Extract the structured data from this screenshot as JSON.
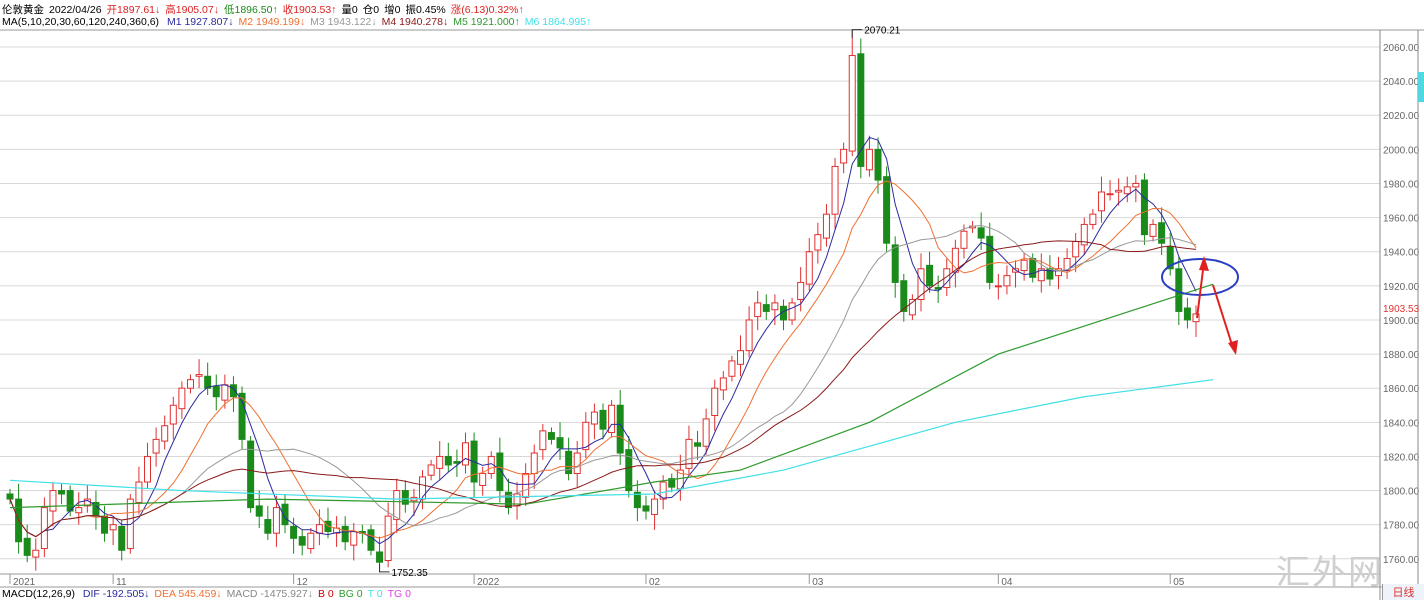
{
  "header": {
    "symbol": "伦敦黄金",
    "date": "2022/04/26",
    "open": "开1897.61↓",
    "high": "高1905.07↓",
    "low": "低1896.50↑",
    "close": "收1903.53↑",
    "vol": "量0",
    "pos": "仓0",
    "inc": "增0",
    "amp": "振0.45%",
    "chg": "涨(6.13)0.32%↑"
  },
  "ma_header": {
    "label": "MA(5,10,20,30,60,120,240,360,6)",
    "items": [
      {
        "text": "M1 1927.807↓",
        "color": "#2a2aa0"
      },
      {
        "text": "M2 1949.199↓",
        "color": "#f07030"
      },
      {
        "text": "M3 1943.122↓",
        "color": "#999999"
      },
      {
        "text": "M4 1940.278↓",
        "color": "#8b1a1a"
      },
      {
        "text": "M5 1921.000↑",
        "color": "#2e9a2e"
      },
      {
        "text": "M6 1864.995↑",
        "color": "#40e0e8"
      }
    ]
  },
  "macd_header": {
    "label": "MACD(12,26,9)",
    "items": [
      {
        "text": "DIF -192.505↓",
        "color": "#2a2aa0"
      },
      {
        "text": "DEA 545.459↓",
        "color": "#f07030"
      },
      {
        "text": "MACD -1475.927↓",
        "color": "#888888"
      },
      {
        "text": "B 0",
        "color": "#c00000"
      },
      {
        "text": "BG 0",
        "color": "#2e9a2e"
      },
      {
        "text": "T 0",
        "color": "#40e0e8"
      },
      {
        "text": "TG 0",
        "color": "#e040e0"
      }
    ]
  },
  "chart_data": {
    "type": "candlestick",
    "ylim": [
      1740,
      2080
    ],
    "y_ticks": [
      1760,
      1780,
      1800,
      1820,
      1840,
      1860,
      1880,
      1900,
      1920,
      1940,
      1960,
      1980,
      2000,
      2020,
      2040,
      2060
    ],
    "x_labels": [
      {
        "text": "2021",
        "index": 0
      },
      {
        "text": "11",
        "index": 12
      },
      {
        "text": "12",
        "index": 33
      },
      {
        "text": "2022",
        "index": 54
      },
      {
        "text": "02",
        "index": 74
      },
      {
        "text": "03",
        "index": 93
      },
      {
        "text": "04",
        "index": 115
      },
      {
        "text": "05",
        "index": 135
      }
    ],
    "closes": [
      1795,
      1770,
      1762,
      1765,
      1790,
      1800,
      1798,
      1788,
      1790,
      1795,
      1785,
      1775,
      1780,
      1765,
      1795,
      1805,
      1820,
      1830,
      1838,
      1850,
      1860,
      1865,
      1868,
      1860,
      1855,
      1862,
      1855,
      1830,
      1790,
      1785,
      1775,
      1790,
      1780,
      1772,
      1768,
      1775,
      1780,
      1776,
      1778,
      1770,
      1776,
      1775,
      1765,
      1758,
      1785,
      1800,
      1792,
      1796,
      1808,
      1815,
      1820,
      1815,
      1816,
      1828,
      1805,
      1810,
      1820,
      1800,
      1790,
      1798,
      1810,
      1822,
      1835,
      1830,
      1825,
      1810,
      1822,
      1840,
      1846,
      1836,
      1850,
      1822,
      1800,
      1790,
      1788,
      1795,
      1805,
      1802,
      1812,
      1830,
      1826,
      1842,
      1860,
      1866,
      1876,
      1882,
      1900,
      1910,
      1905,
      1910,
      1900,
      1910,
      1922,
      1940,
      1950,
      1962,
      1990,
      2000,
      2055,
      1990,
      2000,
      1982,
      1945,
      1922,
      1905,
      1912,
      1930,
      1920,
      1918,
      1930,
      1942,
      1952,
      1955,
      1948,
      1922,
      1920,
      1926,
      1930,
      1935,
      1925,
      1930,
      1924,
      1930,
      1936,
      1946,
      1956,
      1962,
      1975,
      1974,
      1976,
      1978,
      1980,
      1950,
      1956,
      1945,
      1930,
      1905,
      1900,
      1903.53
    ],
    "extremes": {
      "high": "2070.21",
      "low": "1752.35"
    },
    "last_price": "1903.53",
    "ma240": [
      [
        0,
        1790
      ],
      [
        30,
        1795
      ],
      [
        60,
        1792
      ],
      [
        75,
        1805
      ],
      [
        85,
        1812
      ],
      [
        100,
        1840
      ],
      [
        115,
        1880
      ],
      [
        140,
        1921
      ]
    ],
    "ma360": [
      [
        0,
        1806
      ],
      [
        20,
        1800
      ],
      [
        45,
        1795
      ],
      [
        75,
        1798
      ],
      [
        90,
        1812
      ],
      [
        110,
        1840
      ],
      [
        125,
        1855
      ],
      [
        140,
        1865
      ]
    ],
    "colors": {
      "up": "#e03030",
      "down": "#1a8a1a",
      "ma5": "#2a2aa0",
      "ma10": "#f07030",
      "ma20": "#999999",
      "ma30": "#8b1a1a",
      "ma240": "#2e9a2e",
      "ma360": "#40e0e8"
    }
  },
  "watermark": "汇外网",
  "tab_daily": "日线"
}
